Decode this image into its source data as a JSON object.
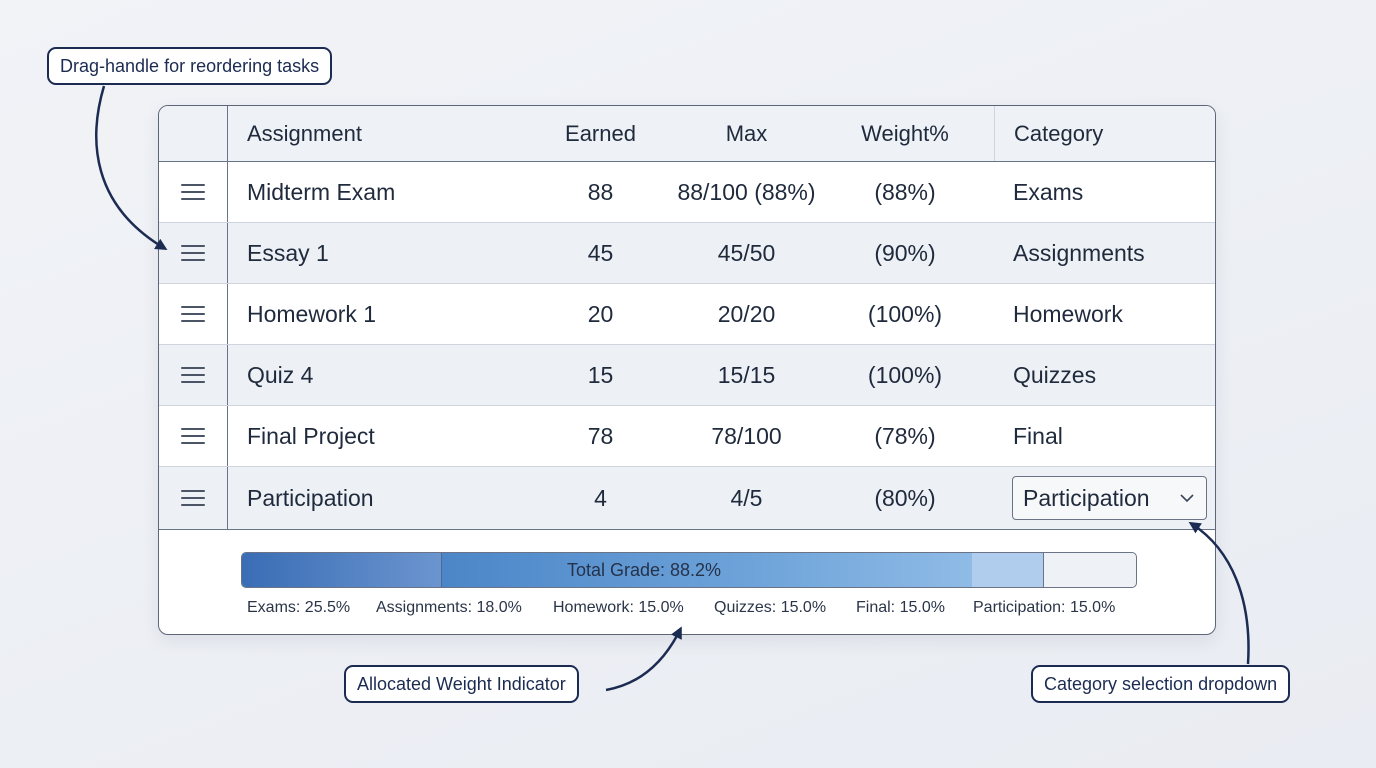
{
  "table": {
    "headers": {
      "assignment": "Assignment",
      "earned": "Earned",
      "max": "Max",
      "weight": "Weight%",
      "category": "Category"
    },
    "rows": [
      {
        "name": "Midterm Exam",
        "earned": "88",
        "max": "88/100 (88%)",
        "weight": "(88%)",
        "category": "Exams"
      },
      {
        "name": "Essay 1",
        "earned": "45",
        "max": "45/50",
        "weight": "(90%)",
        "category": "Assignments"
      },
      {
        "name": "Homework 1",
        "earned": "20",
        "max": "20/20",
        "weight": "(100%)",
        "category": "Homework"
      },
      {
        "name": "Quiz 4",
        "earned": "15",
        "max": "15/15",
        "weight": "(100%)",
        "category": "Quizzes"
      },
      {
        "name": "Final Project",
        "earned": "78",
        "max": "78/100",
        "weight": "(78%)",
        "category": "Final"
      },
      {
        "name": "Participation",
        "earned": "4",
        "max": "4/5",
        "weight": "(80%)",
        "category": "Participation"
      }
    ]
  },
  "weight_bar": {
    "label": "Total Grade: 88.2%",
    "filled_fraction": 0.895,
    "legend": [
      "Exams: 25.5%",
      "Assignments: 18.0%",
      "Homework: 15.0%",
      "Quizzes: 15.0%",
      "Final: 15.0%",
      "Participation: 15.0%"
    ]
  },
  "callouts": {
    "drag_handle": "Drag-handle for reordering tasks",
    "weight_indicator": "Allocated Weight Indicator",
    "category_dropdown": "Category selection dropdown"
  },
  "icons": {
    "drag_handle": "hamburger-icon",
    "dropdown": "chevron-down-icon"
  },
  "colors": {
    "callout": "#1c2b52",
    "bar_primary": "#3a6db5",
    "bar_light": "#b0cdee"
  }
}
